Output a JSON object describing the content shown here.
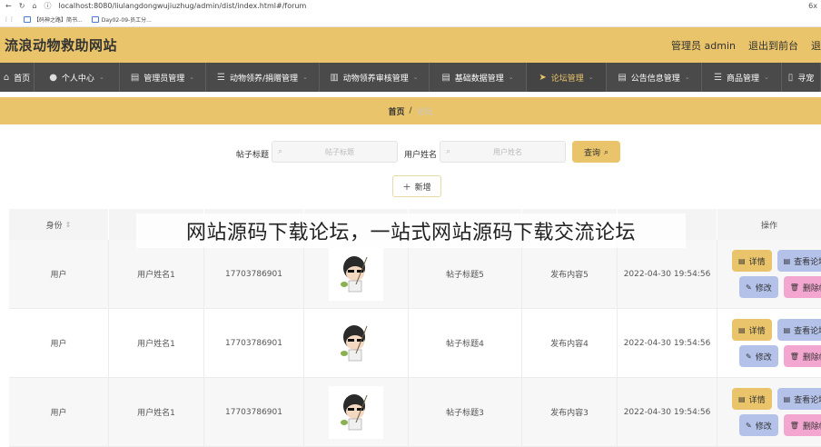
{
  "browser": {
    "url": "localhost:8080/liulangdongwujiuzhug/admin/dist/index.html#/forum",
    "bookmarks": [
      "【码神之路】简书...",
      "Day02-09-员工分..."
    ],
    "right_text": "6x"
  },
  "header": {
    "site_title": "流浪动物救助网站",
    "admin_label": "管理员 admin",
    "exit_label": "退出到前台",
    "logout_fragment": "退"
  },
  "nav": {
    "items": [
      {
        "label": "首页",
        "icon": "home-icon"
      },
      {
        "label": "个人中心",
        "icon": "user-icon"
      },
      {
        "label": "管理员管理",
        "icon": "clipboard-icon"
      },
      {
        "label": "动物领养/捐赠管理",
        "icon": "list-icon"
      },
      {
        "label": "动物领养审核管理",
        "icon": "bar-chart-icon"
      },
      {
        "label": "基础数据管理",
        "icon": "clipboard-icon"
      },
      {
        "label": "论坛管理",
        "icon": "send-icon"
      },
      {
        "label": "公告信息管理",
        "icon": "clipboard-icon"
      },
      {
        "label": "商品管理",
        "icon": "list-icon"
      },
      {
        "label": "寻宠",
        "icon": "phone-icon"
      }
    ],
    "active_index": 6
  },
  "breadcrumb": {
    "home": "首页",
    "separator": "/",
    "current": "论坛"
  },
  "search": {
    "title_label": "帖子标题",
    "title_placeholder": "帖子标题",
    "user_label": "用户姓名",
    "user_placeholder": "用户姓名",
    "query_label": "查询"
  },
  "add_label": "新增",
  "table": {
    "headers": [
      "身份",
      "",
      "",
      "",
      "",
      "",
      "",
      "操作"
    ],
    "rows": [
      {
        "identity": "用户",
        "name": "用户姓名1",
        "phone": "17703786901",
        "title": "帖子标题5",
        "content": "发布内容5",
        "time": "2022-04-30 19:54:56"
      },
      {
        "identity": "用户",
        "name": "用户姓名1",
        "phone": "17703786901",
        "title": "帖子标题4",
        "content": "发布内容4",
        "time": "2022-04-30 19:54:56"
      },
      {
        "identity": "用户",
        "name": "用户姓名1",
        "phone": "17703786901",
        "title": "帖子标题3",
        "content": "发布内容3",
        "time": "2022-04-30 19:54:56"
      }
    ],
    "actions": {
      "detail": "详情",
      "reply": "查看论坛回复",
      "edit": "修改",
      "delete": "删除帖子"
    }
  },
  "overlay_text": "网站源码下载论坛，一站式网站源码下载交流论坛",
  "colors": {
    "accent": "#e9c46a",
    "nav_bg": "#4a4a4a",
    "reply_btn": "#b4c2ea",
    "delete_btn": "#f3a6cf"
  }
}
